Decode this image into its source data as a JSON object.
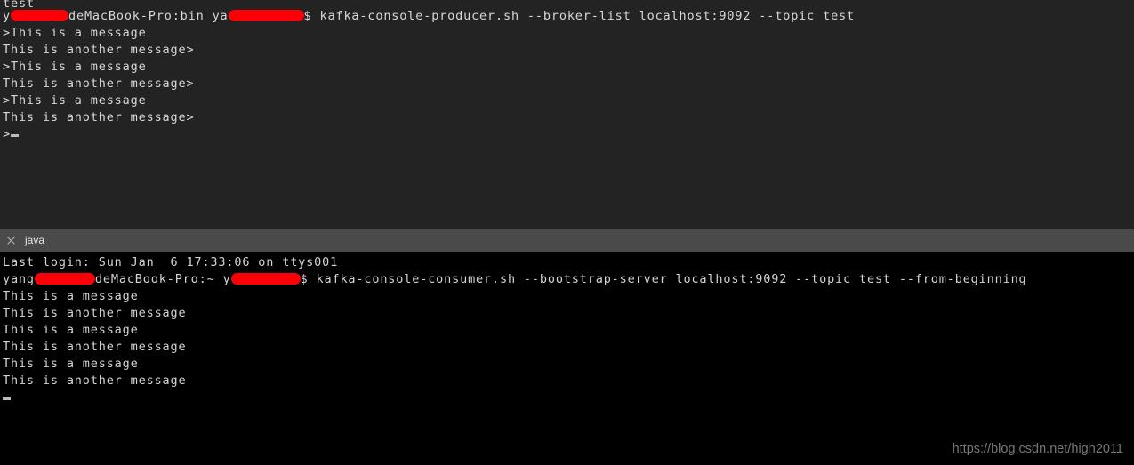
{
  "window": {
    "background_color": "#000000",
    "producer_panel_color": "#232323",
    "consumer_panel_color": "#000000",
    "tabbar_color": "#4a4a4a",
    "redaction_color": "#fb0007",
    "text_color": "#d8d8d8"
  },
  "tabbar": {
    "close_icon": "close-icon",
    "tab_label": "java"
  },
  "producer": {
    "scrollback_fragment": "test",
    "prompt": {
      "pre_host": "y",
      "redaction_1_width": 65,
      "host": "deMacBook-Pro:bin ya",
      "redaction_2_width": 85,
      "dollar": "$",
      "command": "kafka-console-producer.sh --broker-list localhost:9092 --topic test"
    },
    "lines": [
      ">This is a message",
      "This is another message>",
      ">This is a message",
      "This is another message>",
      ">This is a message",
      "This is another message>"
    ],
    "final_prompt": ">",
    "cursor": "block-cursor"
  },
  "consumer": {
    "last_login": "Last login: Sun Jan  6 17:33:06 on ttys001",
    "prompt": {
      "pre_host": "yang",
      "redaction_1_width": 68,
      "host": "deMacBook-Pro:~ y",
      "redaction_2_width": 78,
      "dollar": "$",
      "command": "kafka-console-consumer.sh --bootstrap-server localhost:9092 --topic test --from-beginning"
    },
    "lines": [
      "This is a message",
      "This is another message",
      "This is a message",
      "This is another message",
      "This is a message",
      "This is another message"
    ],
    "cursor": "block-cursor"
  },
  "watermark": {
    "text": "https://blog.csdn.net/high2011"
  }
}
